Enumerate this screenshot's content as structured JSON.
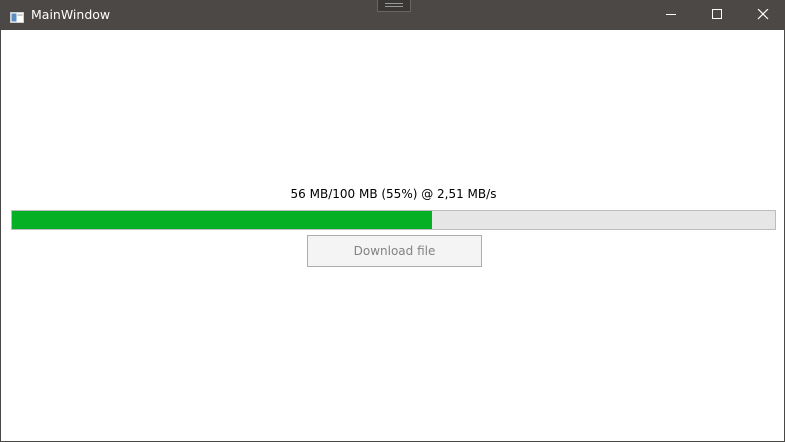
{
  "window": {
    "title": "MainWindow",
    "app_icon": "window-app-icon",
    "controls": {
      "minimize": "minimize-icon",
      "maximize": "maximize-icon",
      "close": "close-icon"
    }
  },
  "download": {
    "status_text": "56 MB/100 MB (55%) @ 2,51 MB/s",
    "progress_fraction": 0.55,
    "button_label": "Download file",
    "button_enabled": false
  },
  "colors": {
    "titlebar": "#4b4845",
    "progress_fill": "#06b025",
    "progress_track": "#e6e6e6"
  }
}
